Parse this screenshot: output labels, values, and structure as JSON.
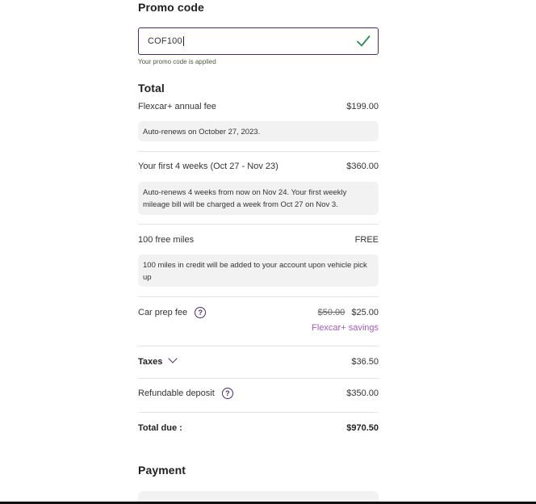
{
  "promo": {
    "heading": "Promo code",
    "value": "COF100",
    "status": "Your promo code is applied",
    "icon": "check-icon"
  },
  "total": {
    "heading": "Total",
    "annual_fee": {
      "label": "Flexcar+ annual fee",
      "amount": "$199.00",
      "note": "Auto-renews on October 27, 2023."
    },
    "first_weeks": {
      "label": "Your first 4 weeks (Oct 27 - Nov 23)",
      "amount": "$360.00",
      "note": "Auto-renews 4 weeks from now on Nov 24. Your first weekly mileage bill will be charged a week from Oct 27 on Nov 3."
    },
    "free_miles": {
      "label": "100 free miles",
      "amount": "FREE",
      "note": "100 miles in credit will be added to your account upon vehicle pick up"
    },
    "car_prep": {
      "label": "Car prep fee",
      "old_amount": "$50.00",
      "amount": "$25.00",
      "savings": "Flexcar+ savings"
    },
    "taxes": {
      "label": "Taxes",
      "amount": "$36.50"
    },
    "deposit": {
      "label": "Refundable deposit",
      "amount": "$350.00"
    },
    "total_due": {
      "label": "Total due :",
      "amount": "$970.50"
    }
  },
  "payment": {
    "heading": "Payment"
  },
  "colors": {
    "accent": "#4a2a73",
    "check": "#2e8b57",
    "savings": "#a45bc7",
    "note_bg": "#f2f2f2"
  }
}
